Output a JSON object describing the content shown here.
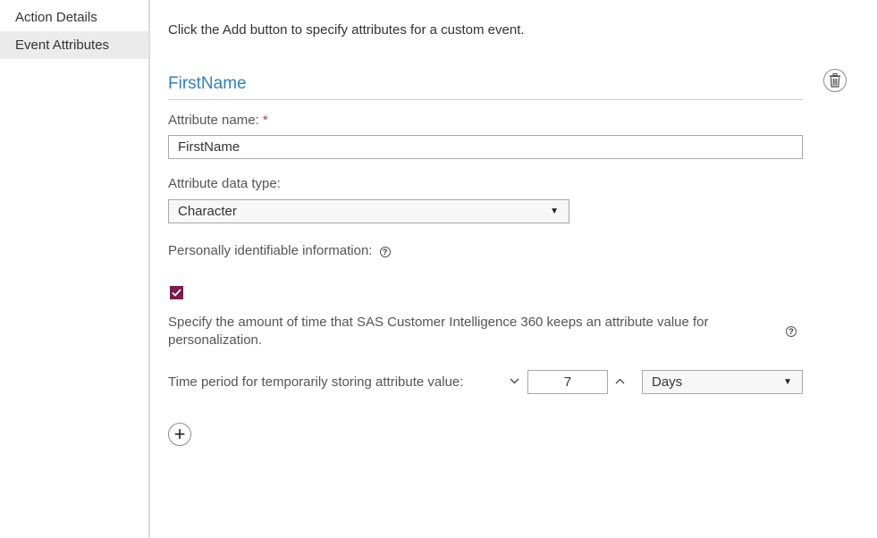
{
  "sidebar": {
    "items": [
      {
        "label": "Action Details"
      },
      {
        "label": "Event Attributes"
      }
    ]
  },
  "main": {
    "intro": "Click the Add button to specify attributes for a custom event.",
    "attribute": {
      "title": "FirstName",
      "name_label": "Attribute name:",
      "required_marker": "*",
      "name_value": "FirstName",
      "type_label": "Attribute data type:",
      "type_value": "Character",
      "pii_label": "Personally identifiable information:",
      "pii_checked": true,
      "retention_desc": "Specify the amount of time that SAS Customer Intelligence 360 keeps an attribute value for personalization.",
      "period_label": "Time period for temporarily storing attribute value:",
      "period_value": "7",
      "period_unit": "Days"
    }
  },
  "icons": {
    "help": "?",
    "caret": "▼",
    "decrement": "⌵",
    "increment": "^",
    "add": "+"
  },
  "colors": {
    "accent": "#2f7fc1",
    "checkbox": "#7b1c4c",
    "required": "#c0392b"
  }
}
